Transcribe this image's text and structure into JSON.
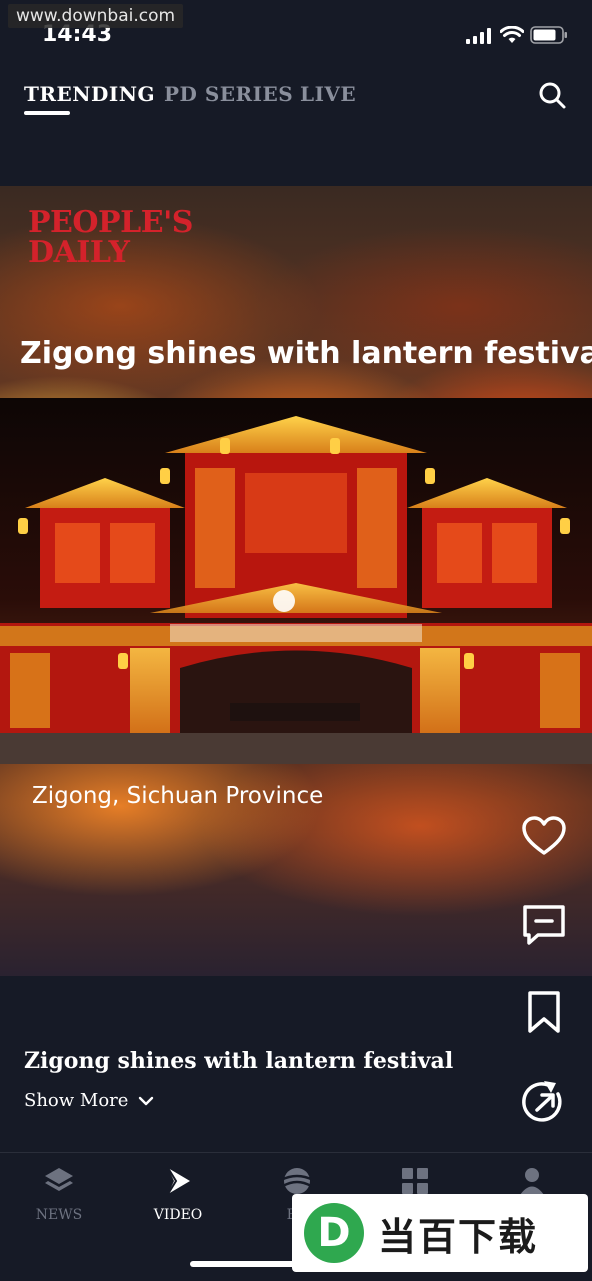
{
  "status_bar": {
    "time": "14:43",
    "watermark": "www.downbai.com",
    "signal_icon": "cellular-signal-icon",
    "wifi_icon": "wifi-icon",
    "battery_icon": "battery-icon"
  },
  "top_tabs": [
    {
      "label": "TRENDING",
      "active": true
    },
    {
      "label": "PD SERIES",
      "active": false
    },
    {
      "label": "LIVE",
      "active": false
    }
  ],
  "search_icon": "search-icon",
  "video": {
    "brand": "PEOPLE'S\nDAILY",
    "title": "Zigong shines with lantern festival",
    "location_caption": "Zigong, Sichuan Province"
  },
  "actions": {
    "like_icon": "heart-icon",
    "comment_icon": "comment-icon",
    "bookmark_icon": "bookmark-icon",
    "share_icon": "share-icon"
  },
  "description": {
    "title": "Zigong shines with lantern festival",
    "show_more": "Show More"
  },
  "bottom_nav": [
    {
      "label": "NEWS",
      "icon": "layers-icon",
      "active": false
    },
    {
      "label": "VIDEO",
      "icon": "play-icon",
      "active": true
    },
    {
      "label": "BR",
      "icon": "globe-icon",
      "active": false
    },
    {
      "label": "",
      "icon": "grid-icon",
      "active": false
    },
    {
      "label": "",
      "icon": "user-icon",
      "active": false
    }
  ],
  "corner_watermark": {
    "logo_letter": "D",
    "text": "当百下载"
  },
  "colors": {
    "background": "#161a26",
    "inactive_text": "#8a8f9c",
    "brand_red": "#d4222b"
  }
}
